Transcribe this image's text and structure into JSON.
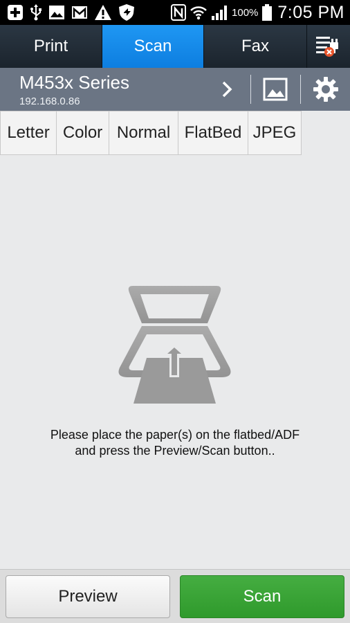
{
  "status_bar": {
    "icons": [
      "plus-icon",
      "usb-icon",
      "image-icon",
      "gmail-icon",
      "warning-icon",
      "shield-icon",
      "nfc-icon",
      "wifi-icon",
      "signal-icon",
      "battery-icon"
    ],
    "battery": "100%",
    "time": "7:05 PM"
  },
  "tabs": [
    {
      "label": "Print",
      "active": false
    },
    {
      "label": "Scan",
      "active": true
    },
    {
      "label": "Fax",
      "active": false
    }
  ],
  "device": {
    "name": "M453x Series",
    "ip": "192.168.0.86"
  },
  "options": [
    "Letter",
    "Color",
    "Normal",
    "FlatBed",
    "JPEG"
  ],
  "instruction": {
    "line1": "Please place the paper(s) on the flatbed/ADF",
    "line2": "and press the Preview/Scan button.."
  },
  "buttons": {
    "preview": "Preview",
    "scan": "Scan"
  },
  "colors": {
    "active_tab": "#1a8ef0",
    "scan_button": "#3aa536",
    "device_bar": "#6b7584"
  }
}
